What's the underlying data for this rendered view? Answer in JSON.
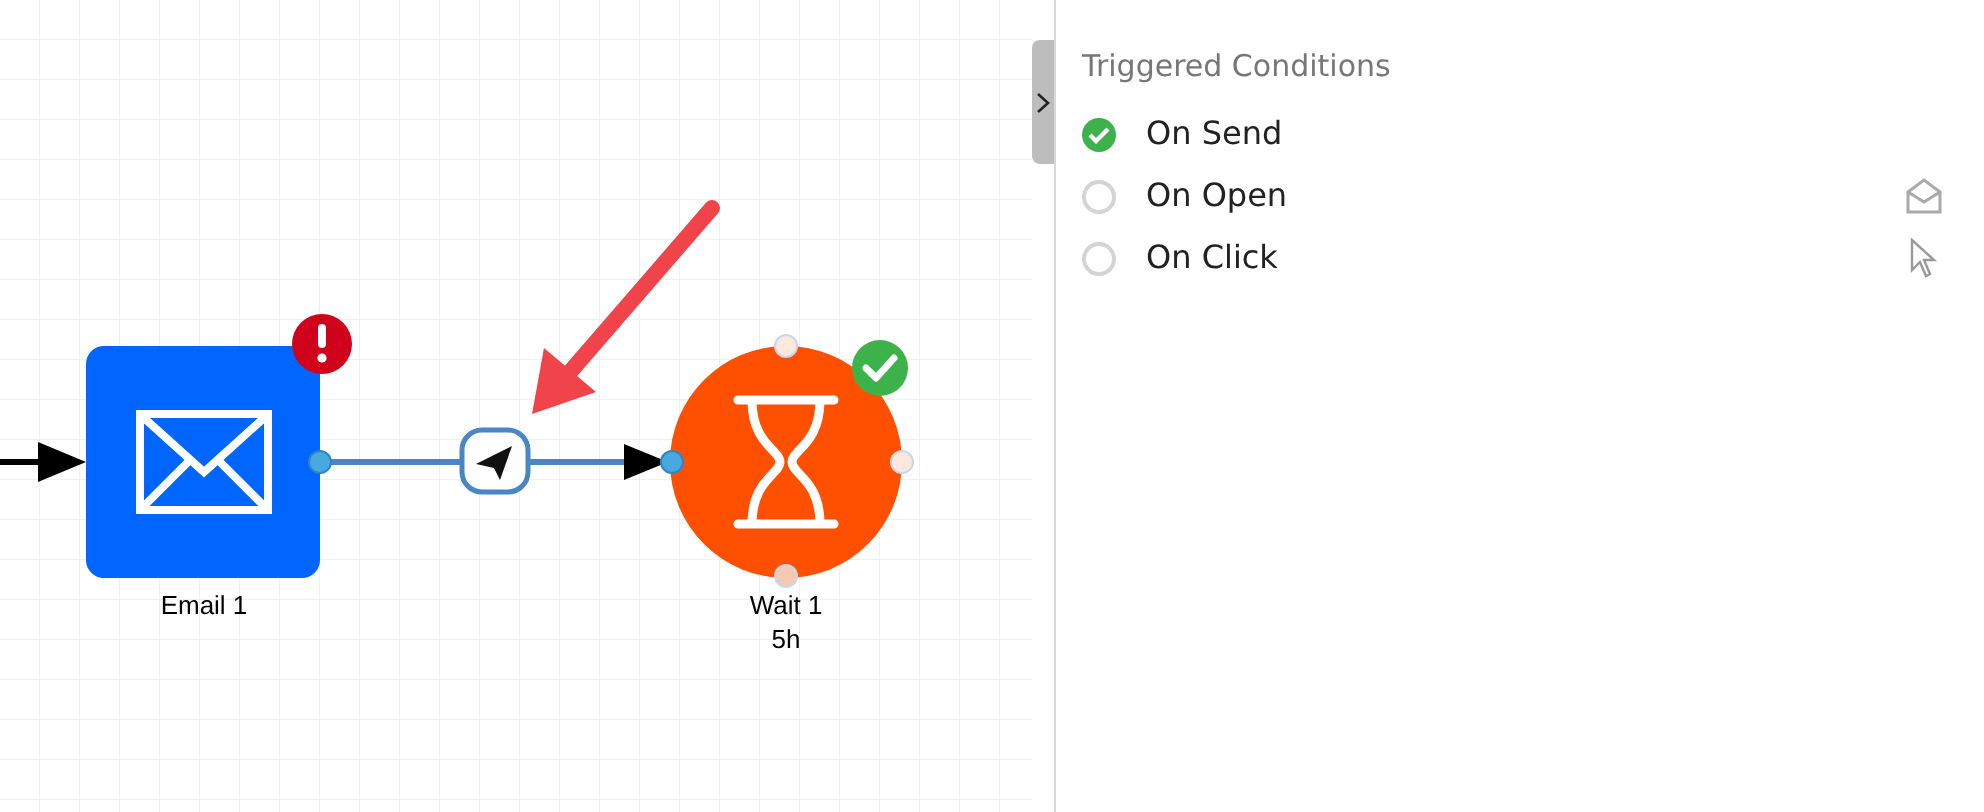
{
  "canvas": {
    "nodes": [
      {
        "kind": "email",
        "label": "Email 1",
        "error": true,
        "complete": false
      },
      {
        "kind": "wait",
        "label": "Wait 1",
        "detail": "5h",
        "error": false,
        "complete": true
      }
    ]
  },
  "panel": {
    "title": "Triggered Conditions",
    "conditions": [
      {
        "label": "On Send",
        "kind": "send",
        "selected": true
      },
      {
        "label": "On Open",
        "kind": "open",
        "selected": false
      },
      {
        "label": "On Click",
        "kind": "click",
        "selected": false
      }
    ]
  }
}
